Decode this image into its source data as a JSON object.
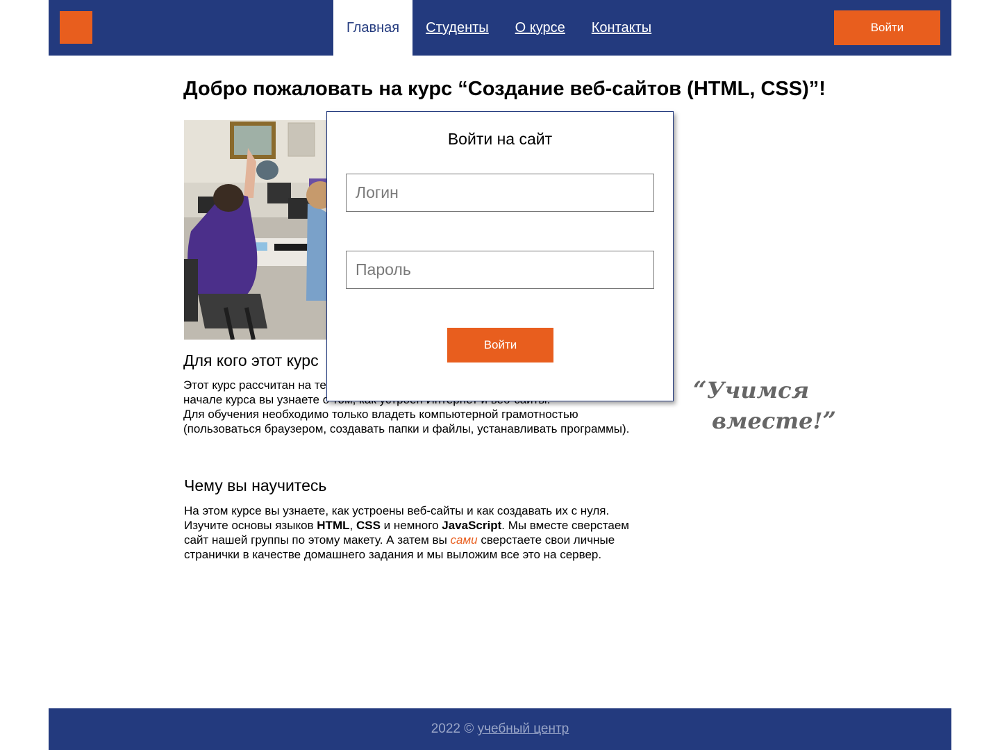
{
  "header": {
    "nav": [
      {
        "label": "Главная",
        "active": true
      },
      {
        "label": "Студенты",
        "active": false
      },
      {
        "label": "О курсе",
        "active": false
      },
      {
        "label": "Контакты",
        "active": false
      }
    ],
    "login_button": "Войти"
  },
  "main": {
    "title": "Добро пожаловать на курс “Создание веб-сайтов (HTML, CSS)”!",
    "image_icon": "classroom-photo",
    "sections": [
      {
        "heading": "Для кого этот курс",
        "paragraphs": [
          "Этот курс рассчитан на тех, кто никогда не сталкивался с веб-разработкой. В начале курса вы узнаете о том, как устроен Интернет и веб-сайты.",
          "Для обучения необходимо только владеть компьютерной грамотностью (пользоваться браузером, создавать папки и файлы, устанавливать программы)."
        ]
      },
      {
        "heading": "Чему вы научитесь",
        "text": {
          "p1": "На этом курсе вы узнаете, как устроены веб-сайты и как создавать их с нуля. Изучите основы языков ",
          "b1": "HTML",
          "p2": ", ",
          "b2": "CSS",
          "p3": " и немного ",
          "b3": "JavaScript",
          "p4": ". Мы вместе сверстаем сайт нашей группы по этому макету. А затем вы ",
          "em": "сами",
          "p5": " сверстаете свои личные странички в качестве домашнего задания и мы выложим все это на сервер."
        }
      }
    ],
    "quote": {
      "open_mark": "“",
      "line1": "Учимся",
      "line2": "вместе!",
      "close_mark": "”"
    }
  },
  "modal": {
    "title": "Войти на сайт",
    "login_placeholder": "Логин",
    "password_placeholder": "Пароль",
    "submit": "Войти"
  },
  "footer": {
    "text": "2022 © ",
    "link": "учебный центр"
  },
  "colors": {
    "brand_blue": "#233a7e",
    "accent_orange": "#e85e1e",
    "quote_gray": "#666666"
  }
}
